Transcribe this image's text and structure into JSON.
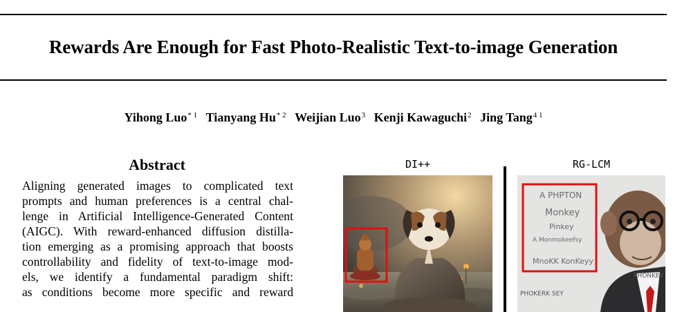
{
  "paper": {
    "title": "Rewards Are Enough for Fast Photo-Realistic Text-to-image Generation",
    "authors": [
      {
        "name": "Yihong Luo",
        "aff": "* 1"
      },
      {
        "name": "Tianyang Hu",
        "aff": "* 2"
      },
      {
        "name": "Weijian Luo",
        "aff": "3"
      },
      {
        "name": "Kenji Kawaguchi",
        "aff": "2"
      },
      {
        "name": "Jing Tang",
        "aff": "4 1"
      }
    ]
  },
  "abstract": {
    "heading": "Abstract",
    "lines": [
      "Aligning generated images to complicated text",
      "prompts and human preferences is a central chal-",
      "lenge in Artificial Intelligence-Generated Content",
      "(AIGC). With reward-enhanced diffusion distilla-",
      "tion emerging as a promising approach that boosts",
      "controllability and fidelity of text-to-image mod-",
      "els, we identify a fundamental paradigm shift:",
      "as conditions become more specific and reward"
    ]
  },
  "figure": {
    "left_caption": "DI++",
    "right_caption": "RG-LCM",
    "right_image_text": [
      "A PHPTON",
      "Monkey",
      "Pinkey",
      "A Monmokeefsy",
      "MnoKK KonKeyy",
      "PHOKERK SEY",
      "PHONKEY"
    ],
    "colors": {
      "highlight_box": "#e01010"
    }
  }
}
